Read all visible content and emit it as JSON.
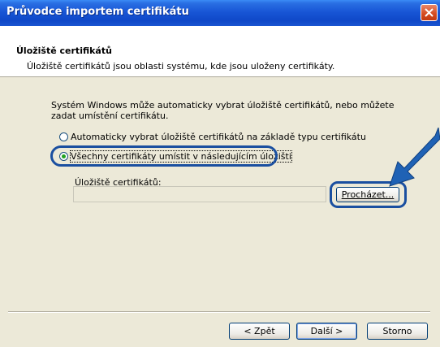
{
  "window": {
    "title": "Průvodce importem certifikátu"
  },
  "header": {
    "title": "Úložiště certifikátů",
    "description": "Úložiště certifikátů jsou oblasti systému, kde jsou uloženy certifikáty."
  },
  "content": {
    "intro": "Systém Windows může automaticky vybrat úložiště certifikátů, nebo můžete zadat umístění certifikátu.",
    "options": [
      {
        "label": "Automaticky vybrat úložiště certifikátů na základě typu certifikátu",
        "selected": false
      },
      {
        "label": "Všechny certifikáty umístit v následujícím úložišti",
        "selected": true
      }
    ],
    "store_label": "Úložiště certifikátů:",
    "store_value": "",
    "browse_label": "Procházet..."
  },
  "footer": {
    "back_label": "< Zpět",
    "next_label": "Další >",
    "cancel_label": "Storno"
  },
  "colors": {
    "titlebar": "#1856d6",
    "highlight": "#1a4fa0",
    "dialog_bg": "#ece9d8"
  }
}
